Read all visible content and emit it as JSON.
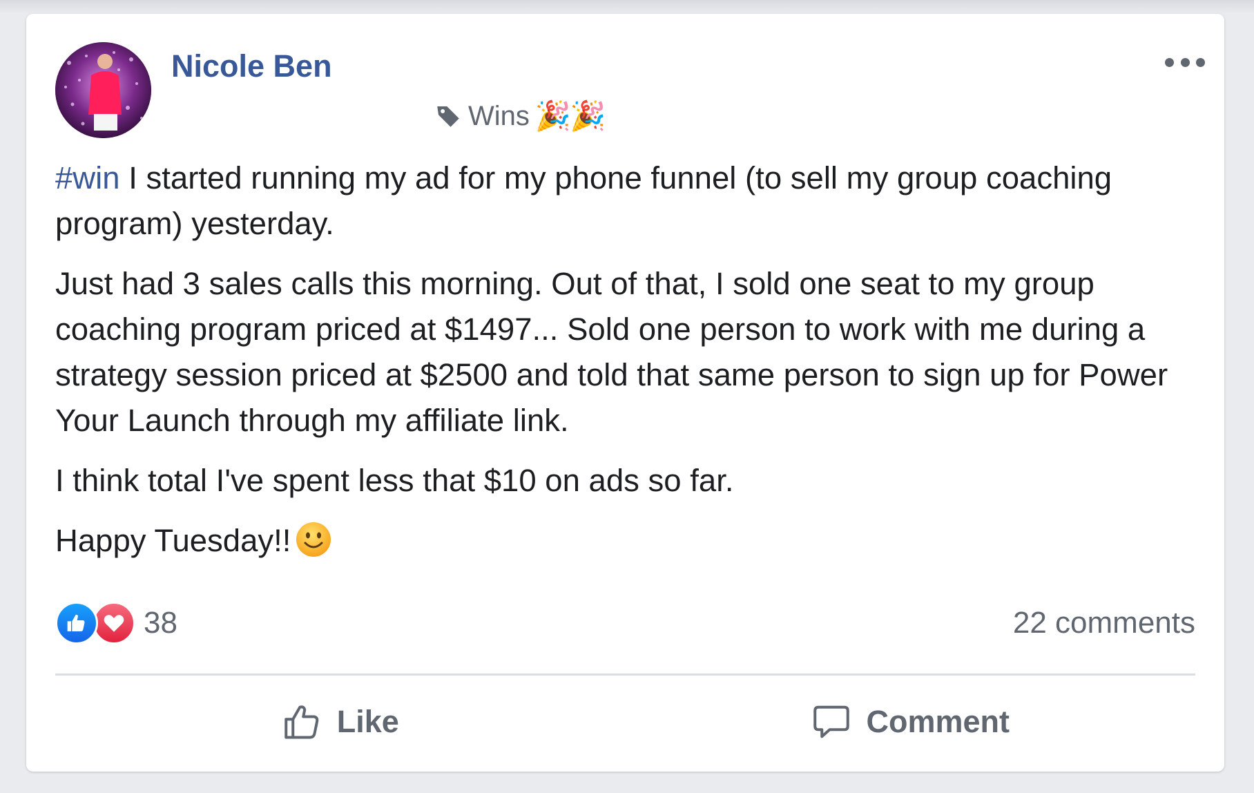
{
  "post": {
    "author": "Nicole Ben",
    "topic_tag": "Wins",
    "topic_emoji": "🎉🎉",
    "hashtag": "#win",
    "paragraph_1_rest": " I started running my ad for my phone funnel (to sell my group coaching program) yesterday.",
    "paragraph_2": "Just had 3 sales calls this morning. Out of that, I sold one seat to my group coaching program priced at $1497... Sold one person to work with me during a strategy session priced at $2500 and told that same person to sign up for Power Your Launch through my affiliate link.",
    "paragraph_3": "I think total I've spent less that $10 on ads so far.",
    "paragraph_4": "Happy Tuesday!!"
  },
  "reactions": {
    "count": "38",
    "types": [
      "like",
      "love"
    ]
  },
  "comments": {
    "label": "22 comments"
  },
  "actions": {
    "like_label": "Like",
    "comment_label": "Comment"
  },
  "colors": {
    "link_blue": "#385898",
    "secondary_text": "#606770",
    "body_text": "#1c1e21",
    "like_blue": "#1877f2",
    "love_red": "#e3223e"
  },
  "icons": [
    "avatar",
    "tag-icon",
    "party-popper-emoji",
    "more-options-icon",
    "smiley-emoji",
    "like-reaction-icon",
    "love-reaction-icon",
    "thumbs-up-icon",
    "comment-bubble-icon"
  ]
}
